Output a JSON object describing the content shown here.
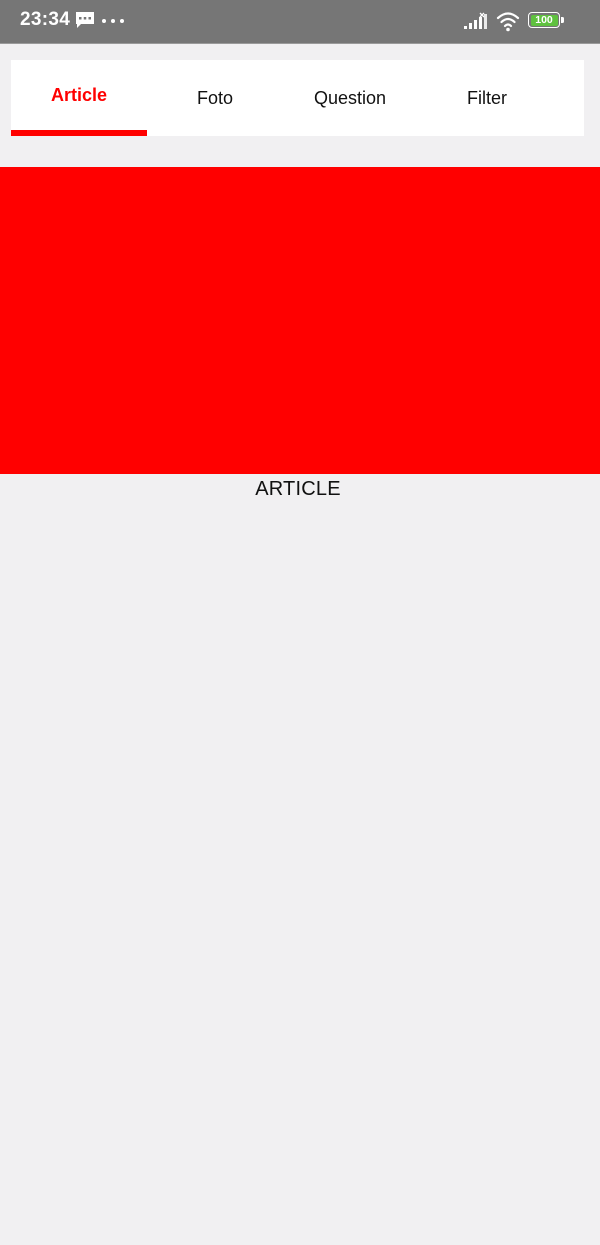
{
  "status_bar": {
    "time": "23:34",
    "battery_level": "100",
    "icons": [
      "message-icon",
      "more-dots-icon",
      "signal-icon",
      "wifi-icon",
      "battery-icon"
    ]
  },
  "tabs": [
    {
      "label": "Article",
      "active": true
    },
    {
      "label": "Foto",
      "active": false
    },
    {
      "label": "Question",
      "active": false
    },
    {
      "label": "Filter",
      "active": false
    }
  ],
  "content": {
    "label": "ARTICLE"
  },
  "colors": {
    "accent": "#ff0000",
    "status_bar": "#767676",
    "background": "#f1f0f2",
    "battery": "#5fc13f"
  }
}
